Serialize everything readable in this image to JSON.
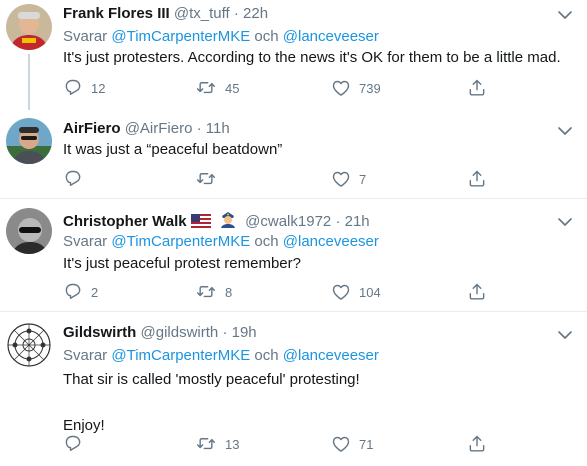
{
  "tweets": [
    {
      "name": "Frank Flores III",
      "handle": "@tx_tuff",
      "time": "22h",
      "reply_prefix": "Svarar",
      "reply_to_1": "@TimCarpenterMKE",
      "reply_join": "och",
      "reply_to_2": "@lanceveeser",
      "text": "It's just protesters. According to the news it's OK for them to be a little mad.",
      "replies": "12",
      "retweets": "45",
      "likes": "739"
    },
    {
      "name": "AirFiero",
      "handle": "@AirFiero",
      "time": "11h",
      "text": "It was just a “peaceful beatdown”",
      "replies": "",
      "retweets": "",
      "likes": "7"
    },
    {
      "name": "Christopher Walk",
      "handle": "@cwalk1972",
      "time": "21h",
      "reply_prefix": "Svarar",
      "reply_to_1": "@TimCarpenterMKE",
      "reply_join": "och",
      "reply_to_2": "@lanceveeser",
      "text": "It's just peaceful protest remember?",
      "replies": "2",
      "retweets": "8",
      "likes": "104"
    },
    {
      "name": "Gildswirth",
      "handle": "@gildswirth",
      "time": "19h",
      "reply_prefix": "Svarar",
      "reply_to_1": "@TimCarpenterMKE",
      "reply_join": "och",
      "reply_to_2": "@lanceveeser",
      "text": "That sir is called 'mostly peaceful' protesting!\n\nEnjoy!",
      "replies": "",
      "retweets": "13",
      "likes": "71"
    }
  ],
  "separator": "·",
  "icons": [
    "reply-icon",
    "retweet-icon",
    "like-icon",
    "share-icon",
    "more-icon",
    "us-flag-icon",
    "police-officer-icon"
  ],
  "colors": {
    "link": "#1b95e0",
    "muted": "#657786",
    "divider": "#e6ecf0",
    "thread": "#ccd6dd"
  }
}
